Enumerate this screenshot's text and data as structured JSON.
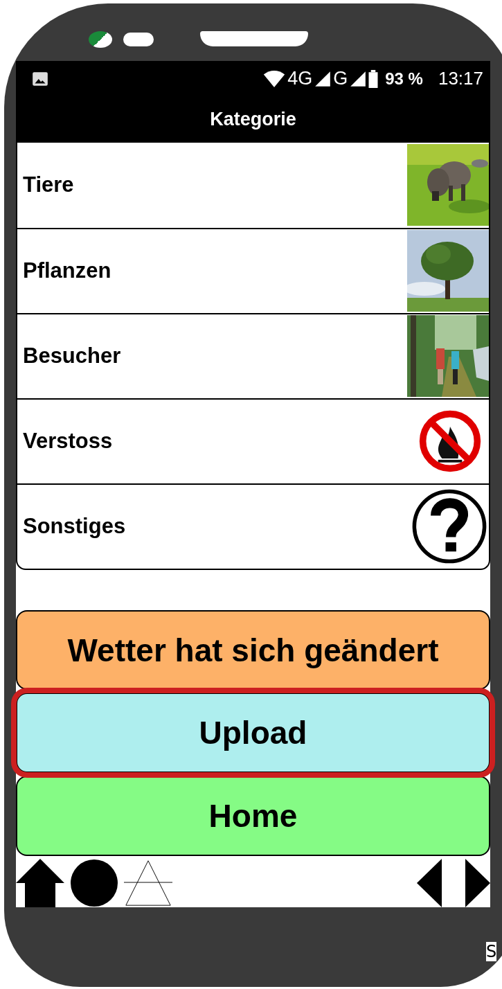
{
  "status_bar": {
    "network_4g": "4G",
    "network_g": "G",
    "battery": "93 %",
    "time": "13:17"
  },
  "title": "Kategorie",
  "categories": [
    {
      "label": "Tiere",
      "kind": "boar"
    },
    {
      "label": "Pflanzen",
      "kind": "tree"
    },
    {
      "label": "Besucher",
      "kind": "hikers"
    },
    {
      "label": "Verstoss",
      "kind": "no-fire"
    },
    {
      "label": "Sonstiges",
      "kind": "question"
    }
  ],
  "buttons": [
    {
      "label": "Wetter hat sich geändert",
      "color": "#fdb168",
      "selected": false
    },
    {
      "label": "Upload",
      "color": "#aeeeee",
      "selected": true
    },
    {
      "label": "Home",
      "color": "#85fb85",
      "selected": false
    }
  ],
  "edge_text": "S"
}
